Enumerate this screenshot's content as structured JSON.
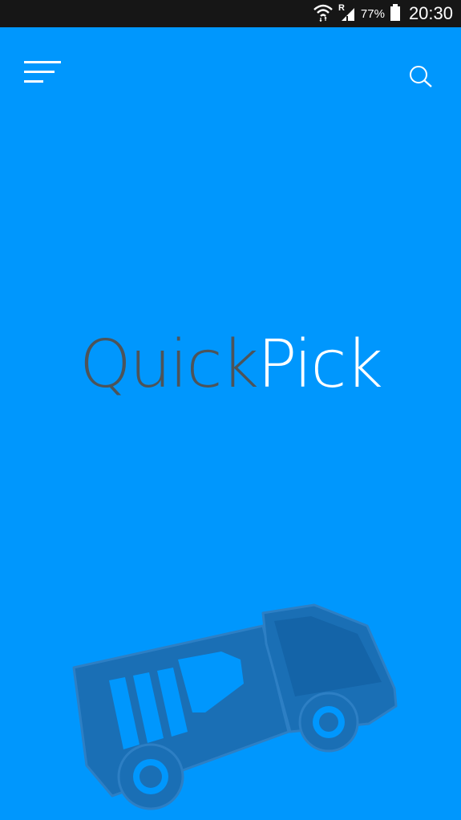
{
  "status_bar": {
    "carrier_badge": "R",
    "battery_percent": "77%",
    "time": "20:30",
    "wifi_icon": "wifi-icon",
    "signal_icon": "signal-icon",
    "battery_icon": "battery-icon"
  },
  "app_bar": {
    "menu_icon": "menu-icon",
    "search_icon": "search-icon"
  },
  "logo": {
    "part1": "Quick",
    "part2": "Pick"
  },
  "illustration": {
    "icon": "delivery-truck-icon"
  },
  "colors": {
    "background": "#0097fd",
    "status_bar": "#161616",
    "logo_dark": "#4d5459",
    "logo_light": "#ffffff",
    "truck": "#1a6fb5"
  }
}
